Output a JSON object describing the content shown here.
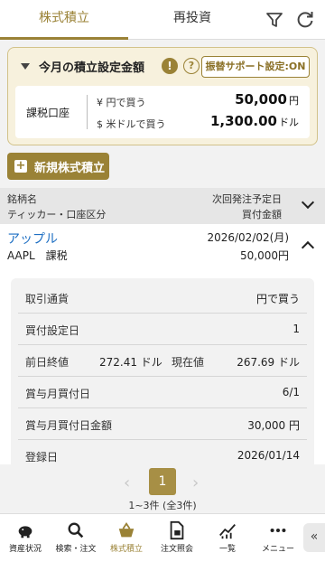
{
  "tabs": {
    "active": "株式積立",
    "other": "再投資"
  },
  "settings": {
    "title": "今月の積立設定金額",
    "warn": "!",
    "help": "?",
    "support_btn": "振替サポート設定:ON",
    "account": "課税口座",
    "rows": [
      {
        "label": "¥ 円で買う",
        "value": "50,000",
        "unit": "円"
      },
      {
        "label": "$ 米ドルで買う",
        "value": "1,300.00",
        "unit": "ドル"
      }
    ]
  },
  "new_button": {
    "plus": "+",
    "label": "新規株式積立"
  },
  "list_header": {
    "left1": "銘柄名",
    "left2": "ティッカー・口座区分",
    "right1": "次回発注予定日",
    "right2": "買付金額"
  },
  "item": {
    "name": "アップル",
    "ticker": "AAPL　課税",
    "date": "2026/02/02(月)",
    "amount": "50,000円"
  },
  "details": {
    "currency_label": "取引通貨",
    "currency_value": "円で買う",
    "buy_day_label": "買付設定日",
    "buy_day_value": "1",
    "prev_close_label": "前日終値",
    "prev_close_value": "272.41 ドル",
    "current_label": "現在値",
    "current_value": "267.69 ドル",
    "bonus_day_label": "賞与月買付日",
    "bonus_day_value": "6/1",
    "bonus_amount_label": "賞与月買付日金額",
    "bonus_amount_value": "30,000 円",
    "reg_label": "登録日",
    "reg_value": "2026/01/14"
  },
  "pager": {
    "prev": "‹",
    "current": "1",
    "next": "›",
    "count": "1~3件 (全3件)"
  },
  "nav": {
    "items": [
      {
        "label": "資産状況"
      },
      {
        "label": "検索・注文"
      },
      {
        "label": "株式積立"
      },
      {
        "label": "注文照会"
      },
      {
        "label": "一覧"
      },
      {
        "label": "メニュー"
      }
    ],
    "collapse": "«"
  },
  "colors": {
    "accent": "#9a8236",
    "link": "#1e6fc3"
  }
}
